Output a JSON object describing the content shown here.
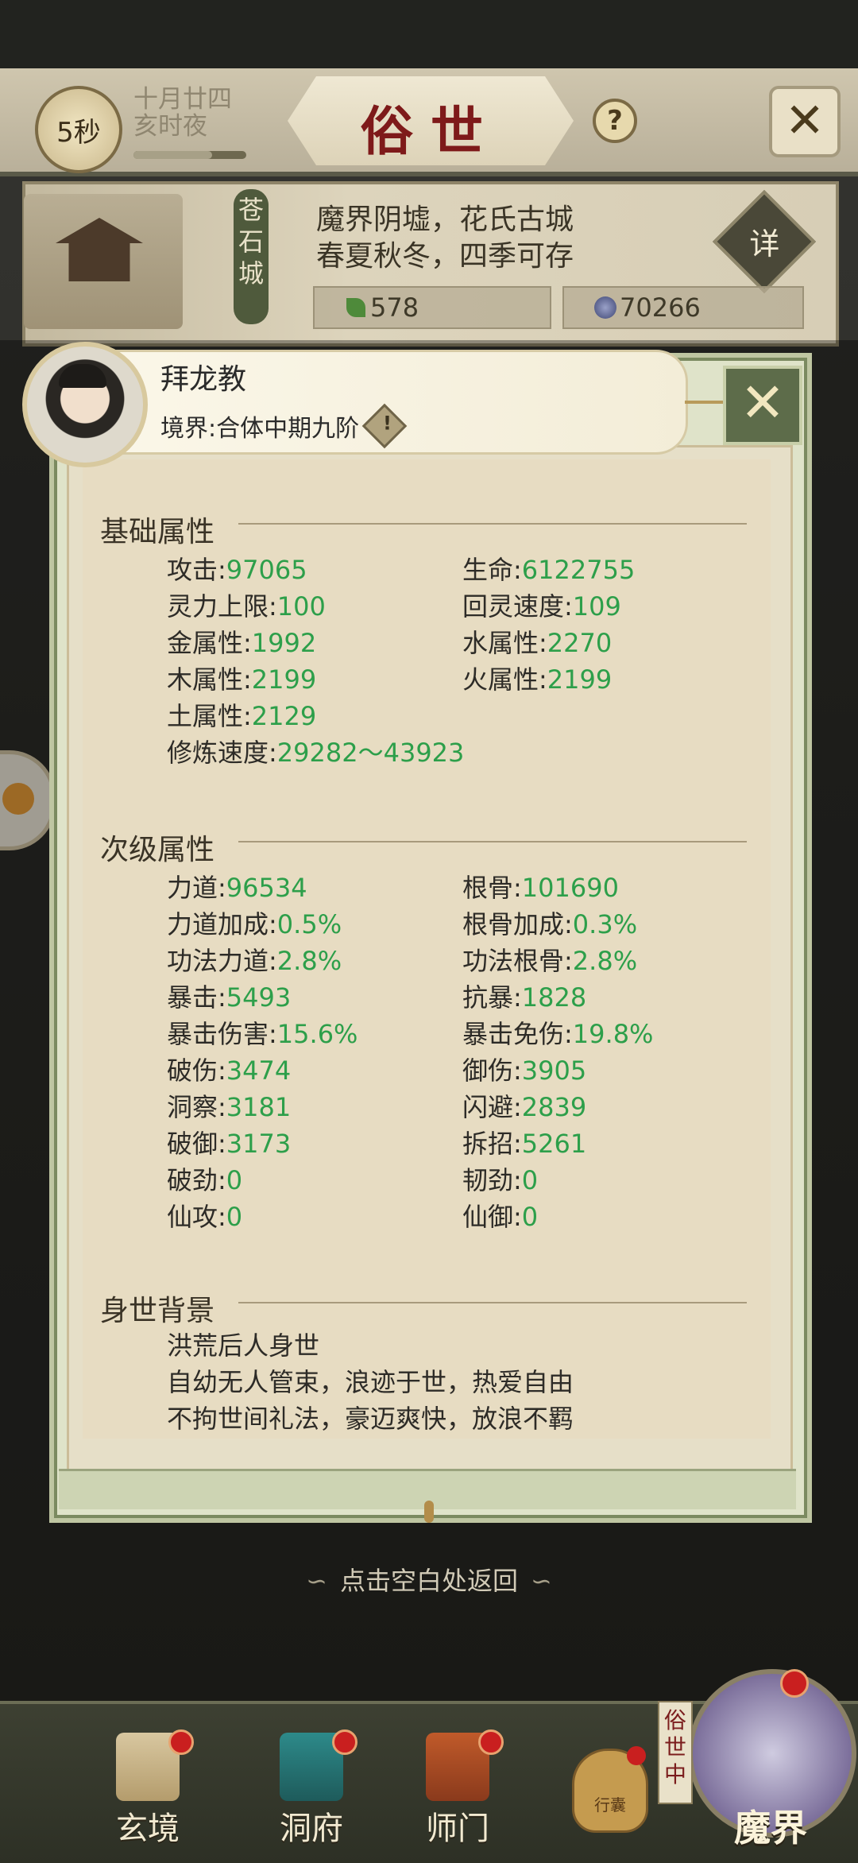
{
  "header": {
    "timer": "5秒",
    "date_line1": "十月廿四",
    "date_line2": "亥时夜",
    "title": "俗世",
    "help": "?"
  },
  "city": {
    "name": "苍石城",
    "desc_line1": "魔界阴墟，花氏古城",
    "desc_line2": "春夏秋冬，四季可存",
    "detail_label": "详",
    "resource1": "578",
    "resource2": "70266"
  },
  "character": {
    "name": "拜龙教",
    "realm": "境界:合体中期九阶"
  },
  "basic": {
    "title": "基础属性",
    "stats": [
      {
        "label": "攻击:",
        "value": "97065"
      },
      {
        "label": "生命:",
        "value": "6122755"
      },
      {
        "label": "灵力上限:",
        "value": "100"
      },
      {
        "label": "回灵速度:",
        "value": "109"
      },
      {
        "label": "金属性:",
        "value": "1992"
      },
      {
        "label": "水属性:",
        "value": "2270"
      },
      {
        "label": "木属性:",
        "value": "2199"
      },
      {
        "label": "火属性:",
        "value": "2199"
      },
      {
        "label": "土属性:",
        "value": "2129"
      },
      {
        "label": "修炼速度:",
        "value": "29282～43923"
      }
    ]
  },
  "secondary": {
    "title": "次级属性",
    "stats": [
      {
        "label": "力道:",
        "value": "96534"
      },
      {
        "label": "根骨:",
        "value": "101690"
      },
      {
        "label": "力道加成:",
        "value": "0.5%"
      },
      {
        "label": "根骨加成:",
        "value": "0.3%"
      },
      {
        "label": "功法力道:",
        "value": "2.8%"
      },
      {
        "label": "功法根骨:",
        "value": "2.8%"
      },
      {
        "label": "暴击:",
        "value": "5493"
      },
      {
        "label": "抗暴:",
        "value": "1828"
      },
      {
        "label": "暴击伤害:",
        "value": "15.6%"
      },
      {
        "label": "暴击免伤:",
        "value": "19.8%"
      },
      {
        "label": "破伤:",
        "value": "3474"
      },
      {
        "label": "御伤:",
        "value": "3905"
      },
      {
        "label": "洞察:",
        "value": "3181"
      },
      {
        "label": "闪避:",
        "value": "2839"
      },
      {
        "label": "破御:",
        "value": "3173"
      },
      {
        "label": "拆招:",
        "value": "5261"
      },
      {
        "label": "破劲:",
        "value": "0"
      },
      {
        "label": "韧劲:",
        "value": "0"
      },
      {
        "label": "仙攻:",
        "value": "0"
      },
      {
        "label": "仙御:",
        "value": "0"
      }
    ]
  },
  "background": {
    "title": "身世背景",
    "lines": [
      "洪荒后人身世",
      "自幼无人管束，浪迹于世，热爱自由",
      "不拘世间礼法，豪迈爽快，放浪不羁"
    ]
  },
  "back_hint": "点击空白处返回",
  "nav": {
    "items": [
      "玄境",
      "洞府",
      "师门"
    ],
    "bag_label": "行囊",
    "mojie_tag": "俗世中",
    "mojie_label": "魔界"
  }
}
